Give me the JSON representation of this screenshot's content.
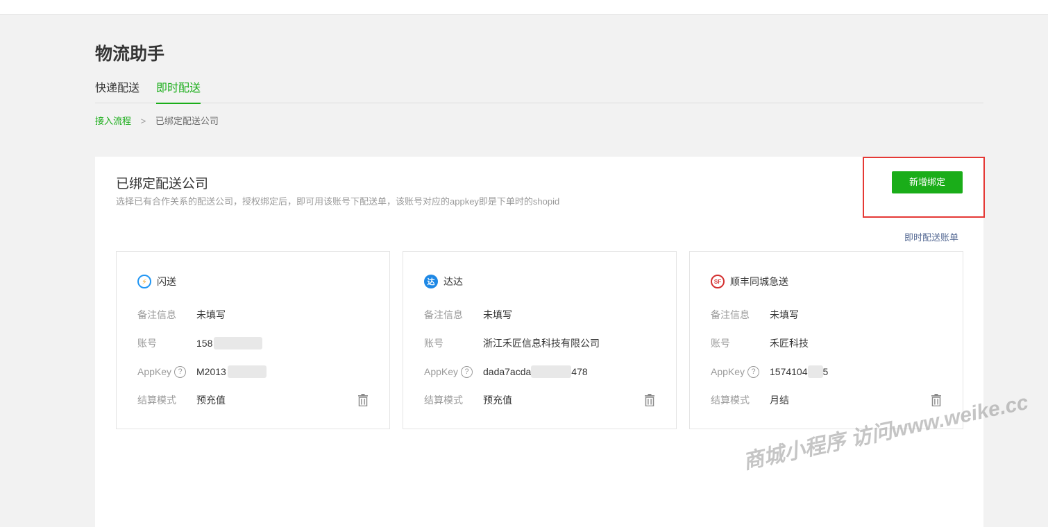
{
  "page": {
    "title": "物流助手"
  },
  "tabs": [
    {
      "label": "快递配送",
      "active": false
    },
    {
      "label": "即时配送",
      "active": true
    }
  ],
  "breadcrumb": {
    "link": "接入流程",
    "separator": ">",
    "current": "已绑定配送公司"
  },
  "panel": {
    "title": "已绑定配送公司",
    "description": "选择已有合作关系的配送公司，授权绑定后，即可用该账号下配送单，该账号对应的appkey即是下单时的shopid",
    "add_button": "新增绑定",
    "bill_link": "即时配送账单"
  },
  "labels": {
    "remark": "备注信息",
    "account": "账号",
    "appkey": "AppKey",
    "appkey_help": "?",
    "settlement": "结算模式"
  },
  "cards": [
    {
      "name": "闪送",
      "logo_icon": "shansong-logo-icon",
      "remark": "未填写",
      "account": "158",
      "appkey": "M2013",
      "settlement": "预充值"
    },
    {
      "name": "达达",
      "logo_icon": "dada-logo-icon",
      "remark": "未填写",
      "account": "浙江禾匠信息科技有限公司",
      "appkey_prefix": "dada7acda",
      "appkey_suffix": "478",
      "settlement": "预充值"
    },
    {
      "name": "顺丰同城急送",
      "logo_icon": "sf-logo-icon",
      "remark": "未填写",
      "account": "禾匠科技",
      "appkey": "1574104",
      "appkey_suffix": "5",
      "settlement": "月结"
    }
  ],
  "logo_glyphs": {
    "shansong": "⚡",
    "dada": "达",
    "sf": "SF"
  },
  "watermark": "商城小程序 访问www.weike.cc",
  "colors": {
    "accent": "#1aad19",
    "link": "#576b95",
    "highlight": "#e53935"
  }
}
